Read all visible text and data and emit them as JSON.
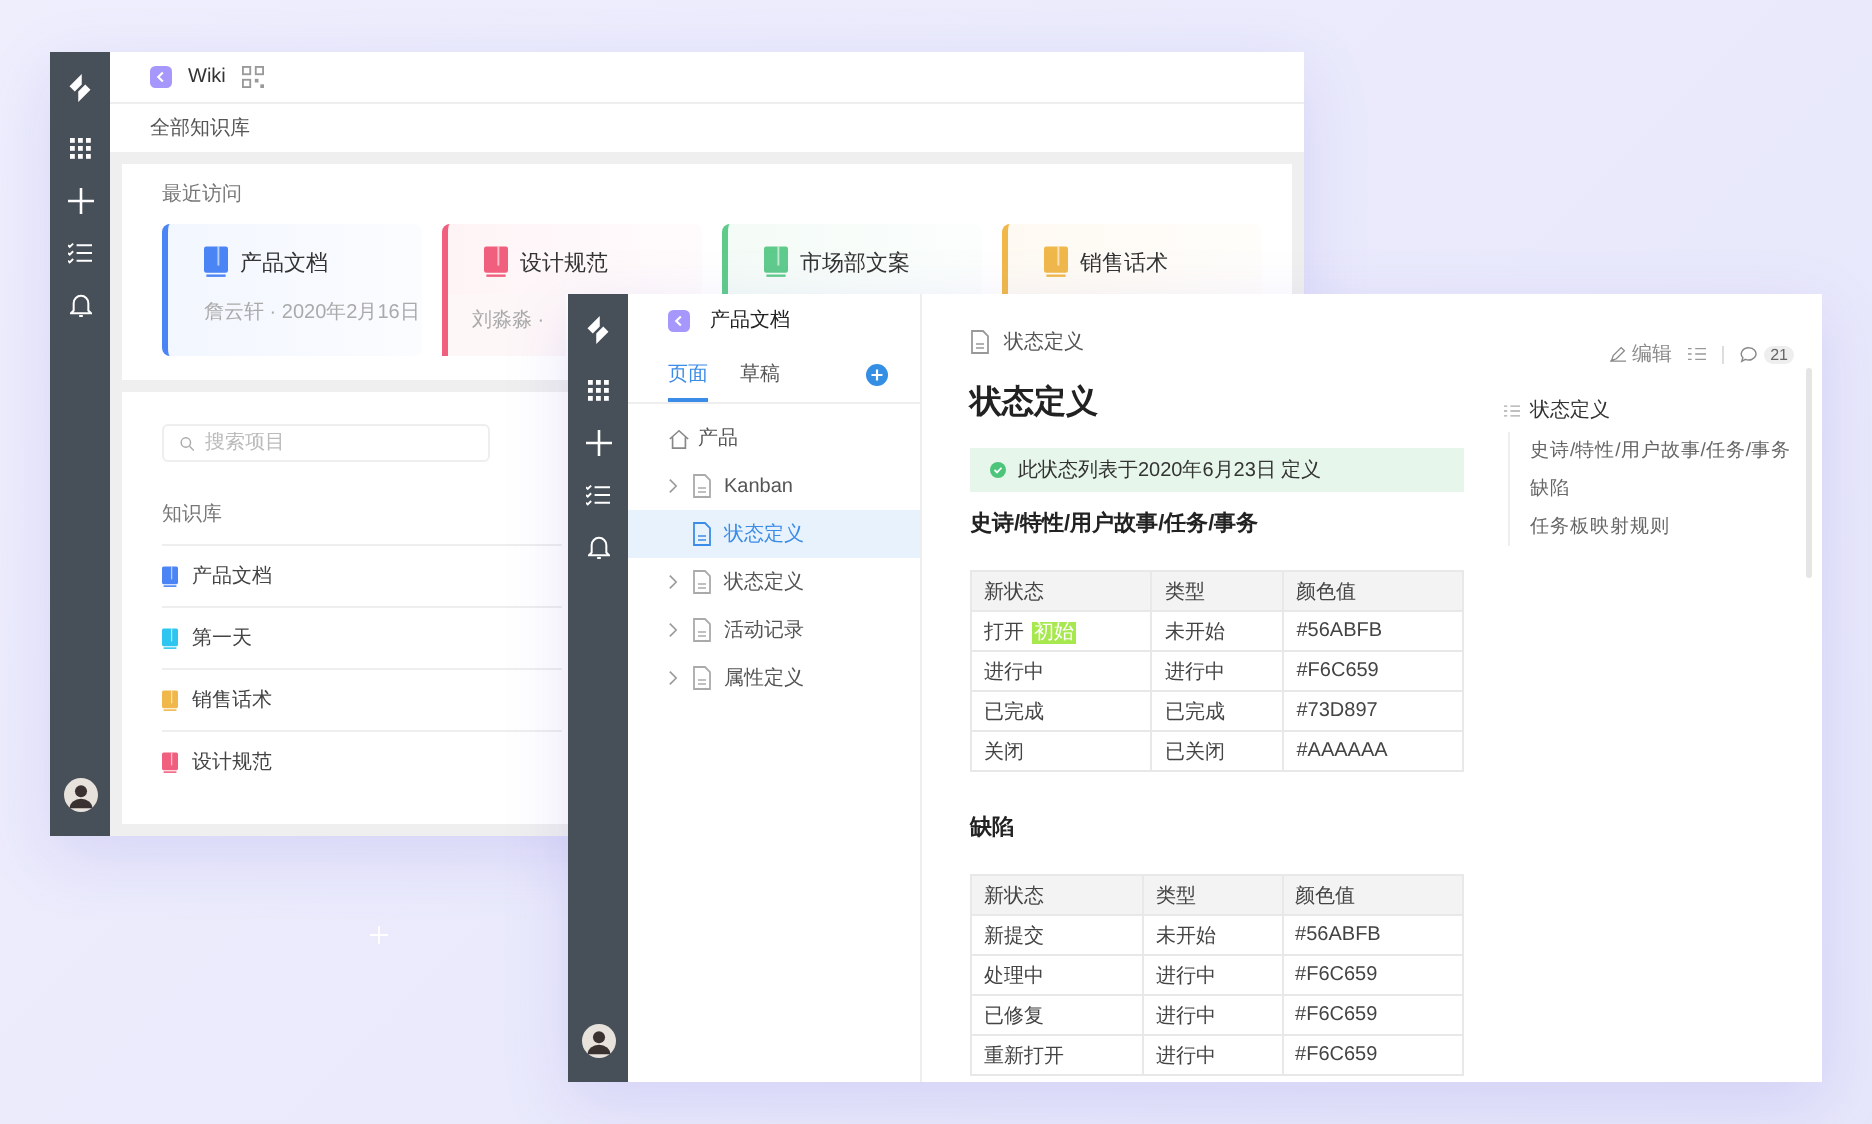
{
  "back_window": {
    "app_title": "Wiki",
    "breadcrumb": "全部知识库",
    "recent": {
      "heading": "最近访问",
      "cards": [
        {
          "title": "产品文档",
          "meta": "詹云轩 · 2020年2月16日",
          "color": "#4a84f5"
        },
        {
          "title": "设计规范",
          "meta": "刘淼淼 ·",
          "color": "#f0607e"
        },
        {
          "title": "市场部文案",
          "color": "#5fcb8b"
        },
        {
          "title": "销售话术",
          "color": "#f0b84a"
        }
      ]
    },
    "search": {
      "placeholder": "搜索项目"
    },
    "library": {
      "heading": "知识库",
      "items": [
        {
          "label": "产品文档",
          "color": "#4a84f5"
        },
        {
          "label": "第一天",
          "color": "#2ec6f0"
        },
        {
          "label": "销售话术",
          "color": "#f0b84a"
        },
        {
          "label": "设计规范",
          "color": "#f0607e"
        }
      ]
    }
  },
  "front_window": {
    "space_title": "产品文档",
    "tabs": [
      {
        "label": "页面",
        "selected": true
      },
      {
        "label": "草稿",
        "selected": false
      }
    ],
    "tree": [
      {
        "label": "产品",
        "selected": false,
        "children": [
          {
            "label": "Kanban",
            "expandable": true,
            "selected": false
          },
          {
            "label": "状态定义",
            "expandable": false,
            "selected": true
          },
          {
            "label": "状态定义",
            "expandable": true,
            "selected": false
          },
          {
            "label": "活动记录",
            "expandable": true,
            "selected": false
          },
          {
            "label": "属性定义",
            "expandable": true,
            "selected": false
          }
        ]
      }
    ],
    "doc": {
      "breadcrumb": "状态定义",
      "edit": "编辑",
      "comments": "21",
      "title": "状态定义",
      "notice": "此状态列表于2020年6月23日 定义",
      "sections": [
        {
          "heading": "史诗/特性/用户故事/任务/事务",
          "columns": [
            "新状态",
            "类型",
            "颜色值"
          ],
          "rows": [
            [
              {
                "text": "打开",
                "tag": "初始"
              },
              {
                "text": "未开始"
              },
              {
                "text": "#56ABFB"
              }
            ],
            [
              {
                "text": "进行中"
              },
              {
                "text": "进行中"
              },
              {
                "text": "#F6C659"
              }
            ],
            [
              {
                "text": "已完成"
              },
              {
                "text": "已完成"
              },
              {
                "text": "#73D897"
              }
            ],
            [
              {
                "text": "关闭"
              },
              {
                "text": "已关闭"
              },
              {
                "text": "#AAAAAA"
              }
            ]
          ]
        },
        {
          "heading": "缺陷",
          "columns": [
            "新状态",
            "类型",
            "颜色值"
          ],
          "rows": [
            [
              {
                "text": "新提交"
              },
              {
                "text": "未开始"
              },
              {
                "text": "#56ABFB"
              }
            ],
            [
              {
                "text": "处理中"
              },
              {
                "text": "进行中"
              },
              {
                "text": "#F6C659"
              }
            ],
            [
              {
                "text": "已修复"
              },
              {
                "text": "进行中"
              },
              {
                "text": "#F6C659"
              }
            ],
            [
              {
                "text": "重新打开"
              },
              {
                "text": "进行中"
              },
              {
                "text": "#F6C659"
              }
            ]
          ]
        }
      ]
    },
    "toc": [
      {
        "label": "状态定义",
        "children": [
          {
            "label": "史诗/特性/用户故事/任务/事务"
          },
          {
            "label": "缺陷"
          },
          {
            "label": "任务板映射规则"
          }
        ]
      }
    ]
  }
}
